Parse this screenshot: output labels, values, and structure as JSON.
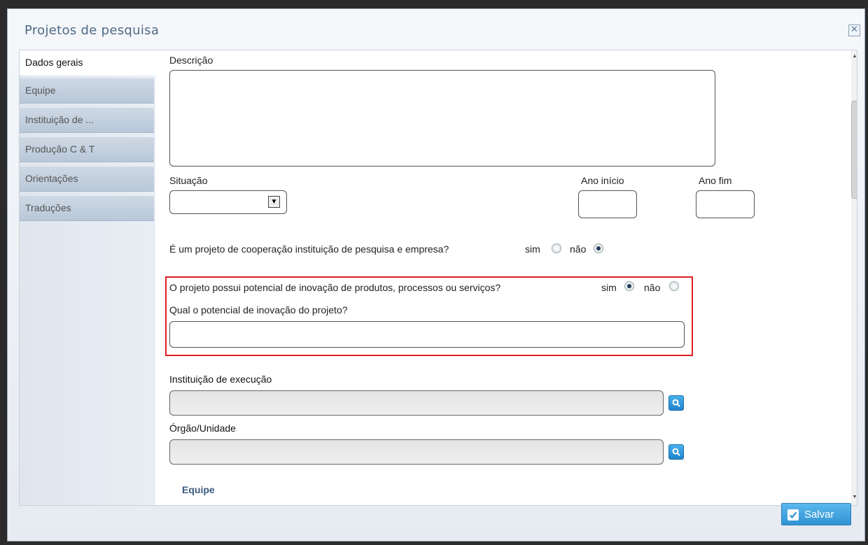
{
  "dialog": {
    "title": "Projetos de pesquisa",
    "close_icon": "close-icon"
  },
  "tabs": [
    {
      "label": "Dados gerais",
      "active": true
    },
    {
      "label": "Equipe",
      "active": false
    },
    {
      "label": "Instituição de ...",
      "active": false
    },
    {
      "label": "Produção C & T",
      "active": false
    },
    {
      "label": "Orientações",
      "active": false
    },
    {
      "label": "Traduções",
      "active": false
    }
  ],
  "form": {
    "descricao_label": "Descrição",
    "descricao_value": "",
    "situacao_label": "Situação",
    "situacao_value": "",
    "ano_inicio_label": "Ano início",
    "ano_inicio_value": "",
    "ano_fim_label": "Ano fim",
    "ano_fim_value": "",
    "cooperacao": {
      "question": "É um projeto de cooperação instituição de pesquisa e empresa?",
      "sim_label": "sim",
      "nao_label": "não",
      "selected": "não"
    },
    "inovacao": {
      "question": "O projeto possui potencial de inovação de produtos, processos ou serviços?",
      "sim_label": "sim",
      "nao_label": "não",
      "selected": "sim",
      "detail_label": "Qual o potencial de inovação do projeto?",
      "detail_value": ""
    },
    "instituicao_label": "Instituição de execução",
    "instituicao_value": "",
    "orgao_label": "Órgão/Unidade",
    "orgao_value": "",
    "equipe_section": "Equipe"
  },
  "footer": {
    "save_label": "Salvar"
  },
  "colors": {
    "accent": "#2f93d3",
    "highlight_border": "#e02020",
    "title": "#4f6a86"
  }
}
